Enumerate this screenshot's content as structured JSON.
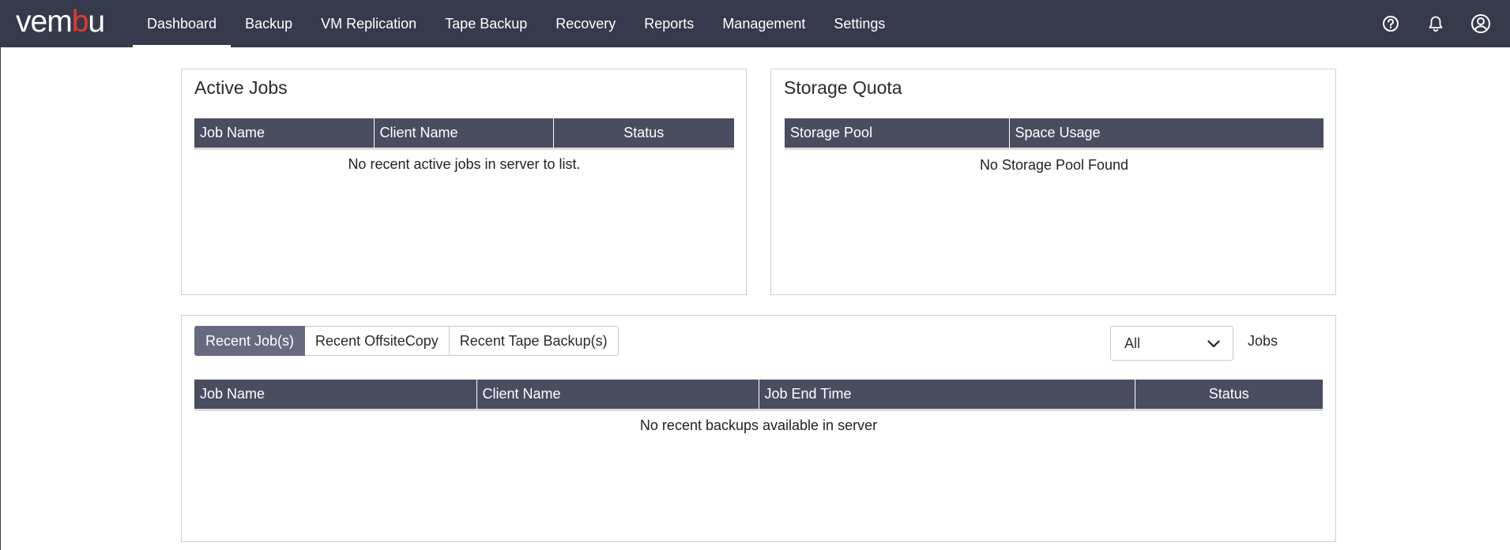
{
  "brand": {
    "logo_prefix": "vem",
    "logo_accent": "b",
    "logo_suffix": "u"
  },
  "nav": {
    "items": [
      {
        "label": "Dashboard",
        "active": true
      },
      {
        "label": "Backup"
      },
      {
        "label": "VM Replication"
      },
      {
        "label": "Tape Backup"
      },
      {
        "label": "Recovery"
      },
      {
        "label": "Reports"
      },
      {
        "label": "Management"
      },
      {
        "label": "Settings"
      }
    ],
    "icons": [
      "help-icon",
      "bell-icon",
      "user-icon"
    ]
  },
  "active_jobs": {
    "title": "Active Jobs",
    "columns": [
      "Job Name",
      "Client Name",
      "Status"
    ],
    "empty_message": "No recent active jobs in server to list."
  },
  "storage_quota": {
    "title": "Storage Quota",
    "columns": [
      "Storage Pool",
      "Space Usage"
    ],
    "empty_message": "No Storage Pool Found"
  },
  "recent": {
    "tabs": [
      {
        "label": "Recent Job(s)",
        "active": true
      },
      {
        "label": "Recent OffsiteCopy"
      },
      {
        "label": "Recent Tape Backup(s)"
      }
    ],
    "filter": {
      "selected": "All"
    },
    "jobs_label": "Jobs",
    "columns": [
      "Job Name",
      "Client Name",
      "Job End Time",
      "Status"
    ],
    "empty_message": "No recent backups available in server"
  },
  "colors": {
    "topbar": "#373a4c",
    "header": "#4a4d60",
    "active_tab": "#676a80",
    "logo_accent": "#e23b2e"
  }
}
